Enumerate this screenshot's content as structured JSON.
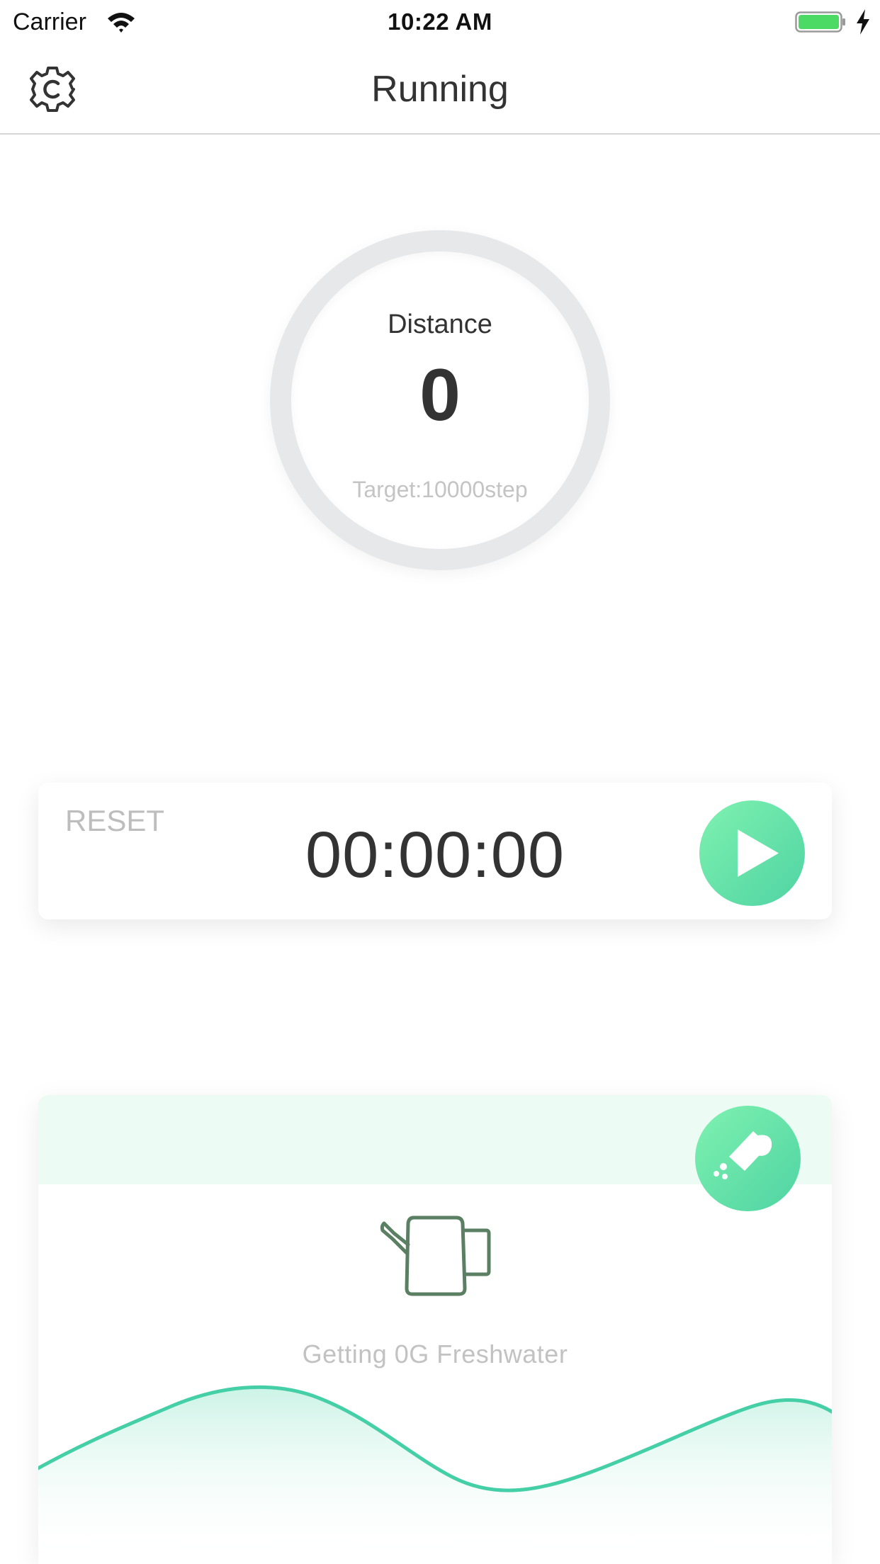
{
  "status_bar": {
    "carrier": "Carrier",
    "time": "10:22 AM",
    "battery_color": "#4cd964"
  },
  "nav": {
    "title": "Running",
    "settings_icon": "gear-icon"
  },
  "distance": {
    "label": "Distance",
    "value": "0",
    "target": "Target:10000step"
  },
  "timer": {
    "reset_label": "RESET",
    "display": "00:00:00",
    "play_icon": "play-icon"
  },
  "water": {
    "status": "Getting 0G Freshwater",
    "button_icon": "watering-icon",
    "illustration_icon": "watering-can-icon"
  },
  "colors": {
    "accent_start": "#7ff2b0",
    "accent_end": "#4fd3a3",
    "wave_line": "#45cfa6",
    "header_tint": "#ecfbf3"
  }
}
